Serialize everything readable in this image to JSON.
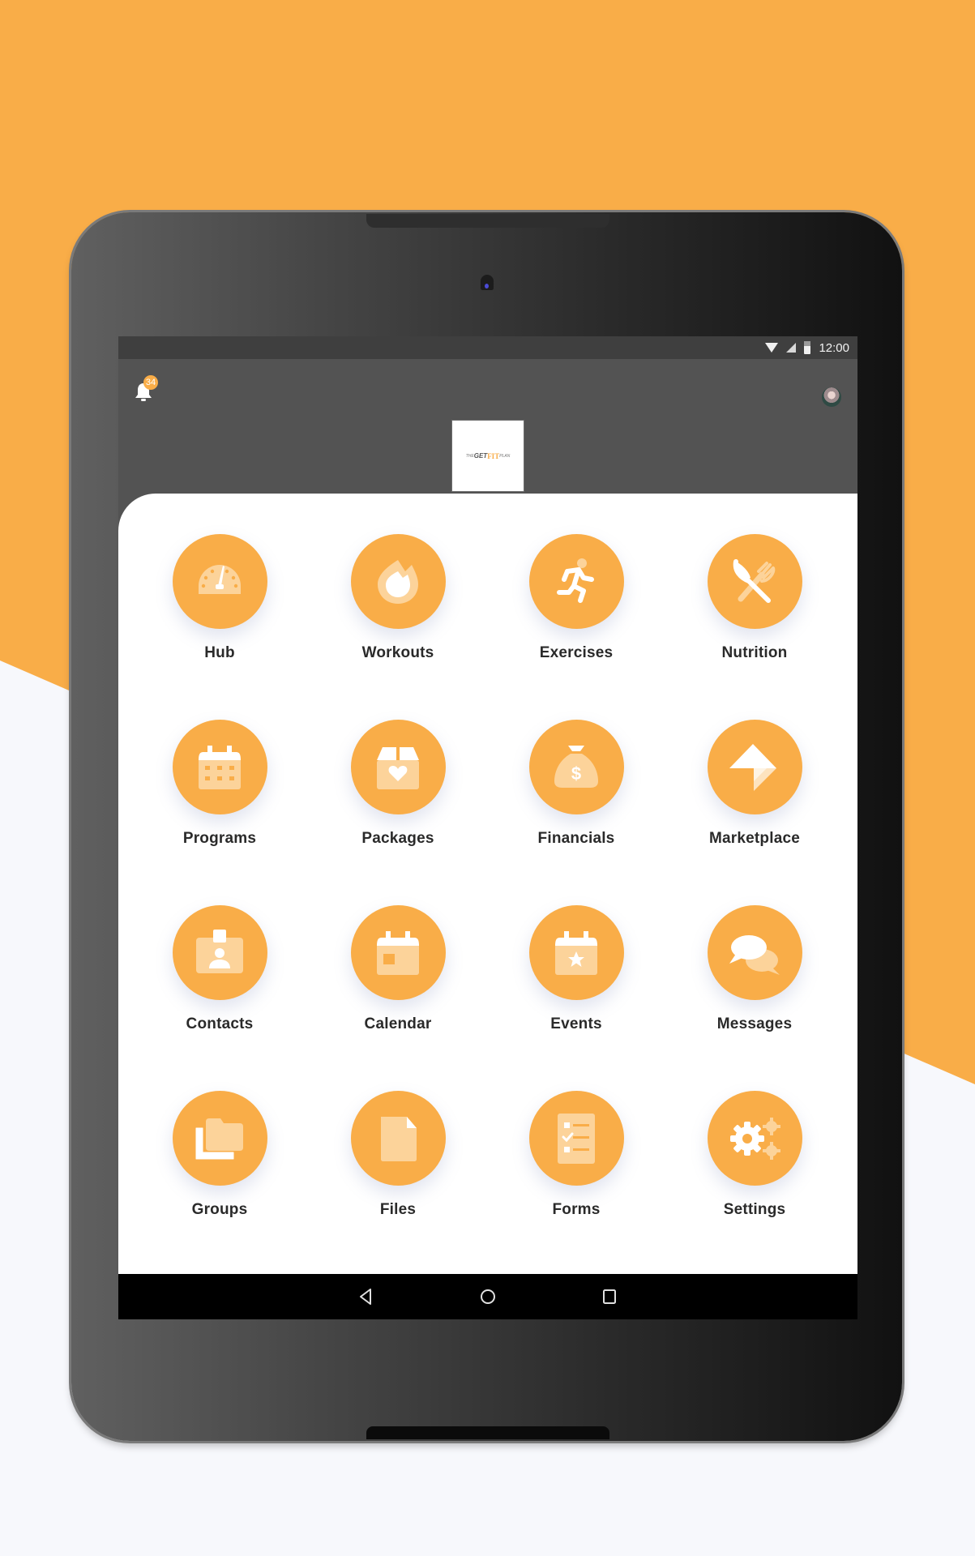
{
  "theme": {
    "accent": "#f9ad48",
    "header_bg": "#535353",
    "statusbar_bg": "#3f3f3f",
    "text": "#2a2a2a"
  },
  "statusbar": {
    "time": "12:00",
    "icons": [
      "wifi-icon",
      "signal-icon",
      "battery-icon"
    ]
  },
  "header": {
    "notifications": {
      "icon": "bell-icon",
      "badge_count": "34"
    },
    "logo": {
      "the": "THE",
      "get": "GET",
      "fit": "FIT",
      "plan": "PLAN"
    },
    "profile": {
      "icon": "avatar"
    }
  },
  "menu": {
    "items": [
      {
        "label": "Hub",
        "icon": "dashboard-gauge-icon"
      },
      {
        "label": "Workouts",
        "icon": "flame-icon"
      },
      {
        "label": "Exercises",
        "icon": "running-person-icon"
      },
      {
        "label": "Nutrition",
        "icon": "knife-fork-icon"
      },
      {
        "label": "Programs",
        "icon": "calendar-grid-icon"
      },
      {
        "label": "Packages",
        "icon": "box-heart-icon"
      },
      {
        "label": "Financials",
        "icon": "money-bag-icon"
      },
      {
        "label": "Marketplace",
        "icon": "marketplace-arrow-icon"
      },
      {
        "label": "Contacts",
        "icon": "contact-badge-icon"
      },
      {
        "label": "Calendar",
        "icon": "calendar-icon"
      },
      {
        "label": "Events",
        "icon": "calendar-star-icon"
      },
      {
        "label": "Messages",
        "icon": "chat-bubbles-icon"
      },
      {
        "label": "Groups",
        "icon": "folders-icon"
      },
      {
        "label": "Files",
        "icon": "file-icon"
      },
      {
        "label": "Forms",
        "icon": "checklist-icon"
      },
      {
        "label": "Settings",
        "icon": "gears-icon"
      }
    ]
  },
  "navbar": {
    "buttons": [
      "back-icon",
      "home-icon",
      "recents-icon"
    ]
  }
}
